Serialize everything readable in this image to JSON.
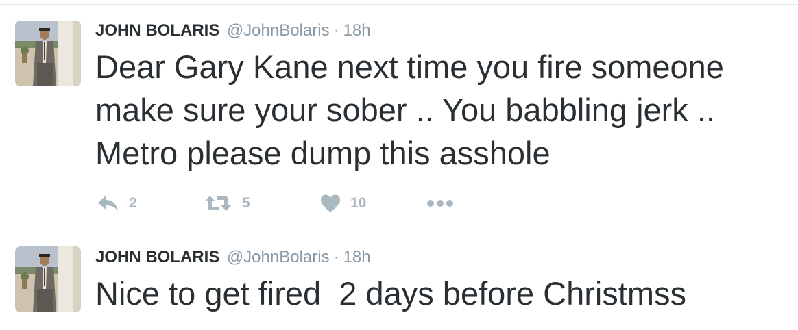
{
  "tweets": [
    {
      "author": {
        "display_name": "JOHN BOLARIS",
        "handle": "@JohnBolaris",
        "avatar_icon": "profile-photo"
      },
      "separator": "·",
      "timestamp": "18h",
      "text": "Dear Gary Kane next time you fire someone\nmake sure your sober .. You babbling jerk ..\nMetro please dump this asshole",
      "actions": {
        "reply_count": "2",
        "retweet_count": "5",
        "like_count": "10",
        "icons": {
          "reply": "reply-arrow-icon",
          "retweet": "retweet-icon",
          "like": "heart-icon",
          "more": "more-dots-icon"
        }
      }
    },
    {
      "author": {
        "display_name": "JOHN BOLARIS",
        "handle": "@JohnBolaris",
        "avatar_icon": "profile-photo"
      },
      "separator": "·",
      "timestamp": "18h",
      "text": "Nice to get fired  2 days before Christmss"
    }
  ],
  "colors": {
    "text": "#292f33",
    "secondary": "#8899a6",
    "action_icon": "#aab8c2",
    "divider": "#e1e8ed"
  }
}
